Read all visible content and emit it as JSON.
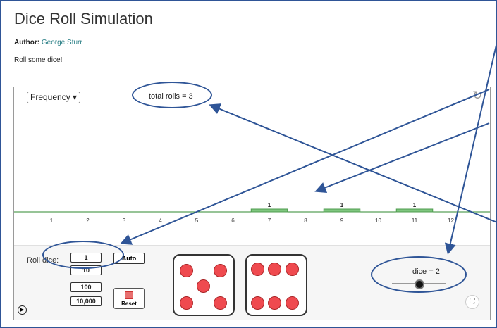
{
  "page": {
    "title": "Dice Roll Simulation",
    "author_label": "Author:",
    "author_name": "George Sturr",
    "description": "Roll some dice!"
  },
  "applet": {
    "dot": "·",
    "dropdown_label": "Frequency ▾",
    "total_rolls": "total rolls = 3",
    "refresh_icon": "↻",
    "axis_ticks": [
      "1",
      "2",
      "3",
      "4",
      "5",
      "6",
      "7",
      "8",
      "9",
      "10",
      "11",
      "12"
    ],
    "chart_data": {
      "type": "bar",
      "categories": [
        1,
        2,
        3,
        4,
        5,
        6,
        7,
        8,
        9,
        10,
        11,
        12
      ],
      "values": [
        0,
        0,
        0,
        0,
        0,
        0,
        1,
        0,
        1,
        0,
        1,
        0
      ],
      "bar_labels": [
        "",
        "",
        "",
        "",
        "",
        "",
        "1",
        "",
        "1",
        "",
        "1",
        ""
      ],
      "ylim": [
        0,
        1
      ]
    },
    "controls": {
      "roll_label": "Roll dice:",
      "roll_buttons": [
        "1",
        "10",
        "100",
        "10,000"
      ],
      "auto_label": "Auto",
      "reset_label": "Reset",
      "dice_label": "dice = 2",
      "dice_value": 2
    },
    "dice": [
      {
        "name": "die-one",
        "pips": 5
      },
      {
        "name": "die-two",
        "pips": 6
      }
    ]
  },
  "colors": {
    "bar": "#7fc67f",
    "pip": "#ef4a4f",
    "annotation": "#2f5597"
  }
}
